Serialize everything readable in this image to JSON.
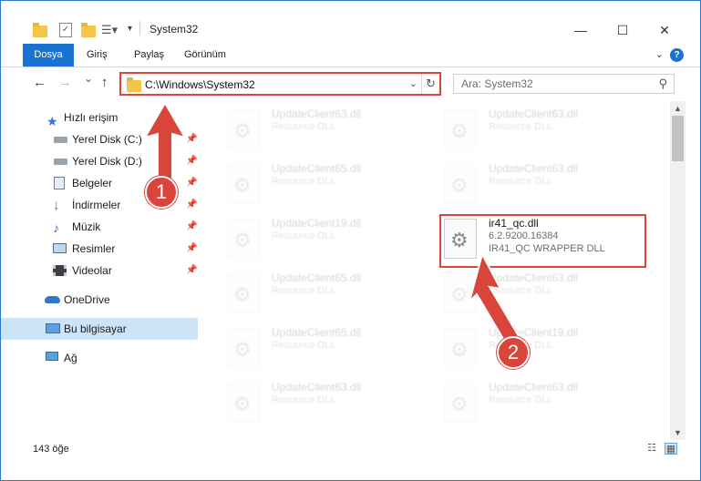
{
  "window": {
    "title": "System32",
    "minimize": "—",
    "maximize": "☐",
    "close": "✕"
  },
  "ribbon": {
    "tabs": [
      "Dosya",
      "Giriş",
      "Paylaş",
      "Görünüm"
    ],
    "help": "?"
  },
  "nav": {
    "back": "←",
    "forward": "→",
    "recent": "⌄",
    "up": "↑",
    "address": "C:\\Windows\\System32",
    "search_placeholder": "Ara: System32"
  },
  "sidebar": {
    "items": [
      {
        "label": "Hızlı erişim",
        "icon": "star-icon",
        "pinned": false
      },
      {
        "label": "Yerel Disk (C:)",
        "icon": "drive-icon",
        "pinned": true
      },
      {
        "label": "Yerel Disk (D:)",
        "icon": "drive-icon",
        "pinned": true
      },
      {
        "label": "Belgeler",
        "icon": "documents-icon",
        "pinned": true
      },
      {
        "label": "İndirmeler",
        "icon": "download-icon",
        "pinned": true
      },
      {
        "label": "Müzik",
        "icon": "music-icon",
        "pinned": true
      },
      {
        "label": "Resimler",
        "icon": "pictures-icon",
        "pinned": true
      },
      {
        "label": "Videolar",
        "icon": "videos-icon",
        "pinned": true
      },
      {
        "label": "OneDrive",
        "icon": "cloud-icon",
        "pinned": false
      },
      {
        "label": "Bu bilgisayar",
        "icon": "computer-icon",
        "pinned": false
      },
      {
        "label": "Ağ",
        "icon": "network-icon",
        "pinned": false
      }
    ]
  },
  "files": [
    {
      "name": "UpdateClient63.dll",
      "line2": "Resource DLL",
      "line3": ""
    },
    {
      "name": "UpdateClient63.dll",
      "line2": "Resource DLL",
      "line3": ""
    },
    {
      "name": "UpdateClient65.dll",
      "line2": "Resource DLL",
      "line3": ""
    },
    {
      "name": "UpdateClient63.dll",
      "line2": "Resource DLL",
      "line3": ""
    },
    {
      "name": "UpdateClient19.dll",
      "line2": "Resource DLL",
      "line3": ""
    },
    {
      "name": "ir41_qc.dll",
      "line2": "6.2.9200.16384",
      "line3": "IR41_QC WRAPPER DLL"
    },
    {
      "name": "UpdateClient65.dll",
      "line2": "Resource DLL",
      "line3": ""
    },
    {
      "name": "UpdateClient63.dll",
      "line2": "Resource DLL",
      "line3": ""
    },
    {
      "name": "UpdateClient65.dll",
      "line2": "Resource DLL",
      "line3": ""
    },
    {
      "name": "UpdateClient19.dll",
      "line2": "Resource DLL",
      "line3": ""
    },
    {
      "name": "UpdateClient63.dll",
      "line2": "Resource DLL",
      "line3": ""
    },
    {
      "name": "UpdateClient63.dll",
      "line2": "Resource DLL",
      "line3": ""
    }
  ],
  "status": {
    "count": "143 öğe"
  },
  "callouts": {
    "one": "1",
    "two": "2"
  },
  "colors": {
    "accent": "#1a73d1",
    "callout": "#d9443b",
    "selected": "#cce4f7"
  }
}
